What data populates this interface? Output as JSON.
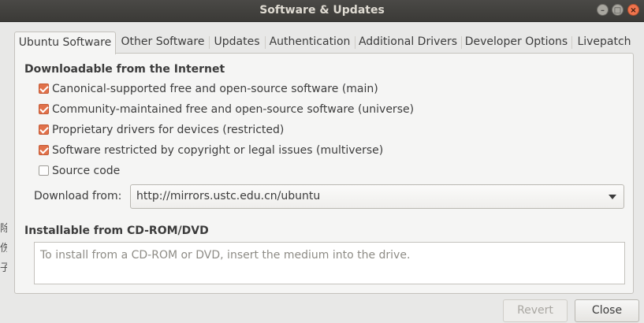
{
  "window": {
    "title": "Software & Updates",
    "controls": {
      "minimize": "–",
      "maximize": "□",
      "close": "×"
    }
  },
  "background_glimpse": [
    "除",
    "伤",
    "子"
  ],
  "tabs": [
    {
      "label": "Ubuntu Software",
      "active": true
    },
    {
      "label": "Other Software",
      "active": false
    },
    {
      "label": "Updates",
      "active": false
    },
    {
      "label": "Authentication",
      "active": false
    },
    {
      "label": "Additional Drivers",
      "active": false
    },
    {
      "label": "Developer Options",
      "active": false
    },
    {
      "label": "Livepatch",
      "active": false
    }
  ],
  "downloadable": {
    "title": "Downloadable from the Internet",
    "sources": [
      {
        "label": "Canonical-supported free and open-source software (main)",
        "checked": true
      },
      {
        "label": "Community-maintained free and open-source software (universe)",
        "checked": true
      },
      {
        "label": "Proprietary drivers for devices (restricted)",
        "checked": true
      },
      {
        "label": "Software restricted by copyright or legal issues (multiverse)",
        "checked": true
      },
      {
        "label": "Source code",
        "checked": false
      }
    ],
    "download_from_label": "Download from:",
    "download_from_value": "http://mirrors.ustc.edu.cn/ubuntu"
  },
  "cdrom": {
    "title": "Installable from CD-ROM/DVD",
    "placeholder": "To install from a CD-ROM or DVD, insert the medium into the drive."
  },
  "buttons": {
    "revert": "Revert",
    "close": "Close"
  },
  "colors": {
    "accent": "#e0714a",
    "titlebar": "#3b3a37",
    "close_button": "#f0744d"
  }
}
